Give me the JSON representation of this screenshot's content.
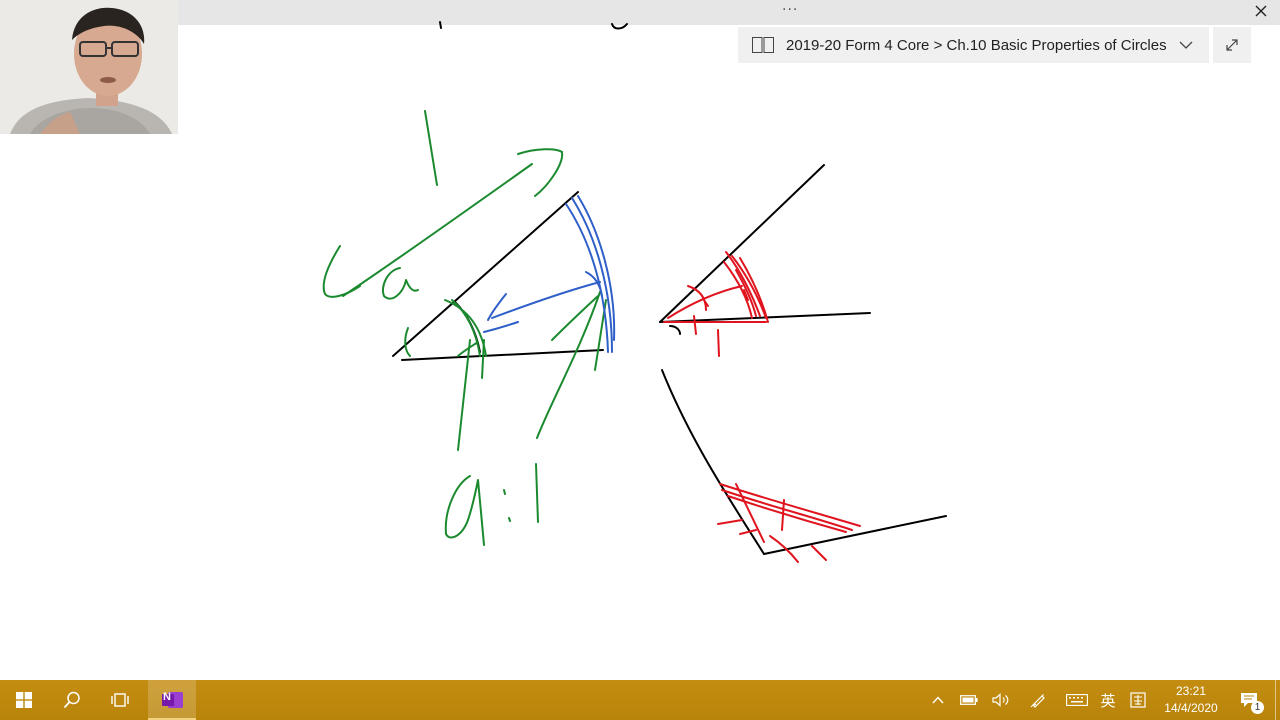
{
  "breadcrumb": {
    "path": "2019-20 Form 4 Core > Ch.10 Basic Properties of Circles"
  },
  "top_bar": {
    "dots": "···"
  },
  "taskbar": {
    "ime_label": "英",
    "time": "23:21",
    "date": "14/4/2020",
    "notification_count": "1",
    "onenote_letter": "N"
  },
  "colors": {
    "taskbar": "#c08a10",
    "ink_black": "#000000",
    "ink_green": "#1b8a2f",
    "ink_blue": "#2f5fc8",
    "ink_red": "#e0141e",
    "onenote_purple": "#7719aa"
  }
}
